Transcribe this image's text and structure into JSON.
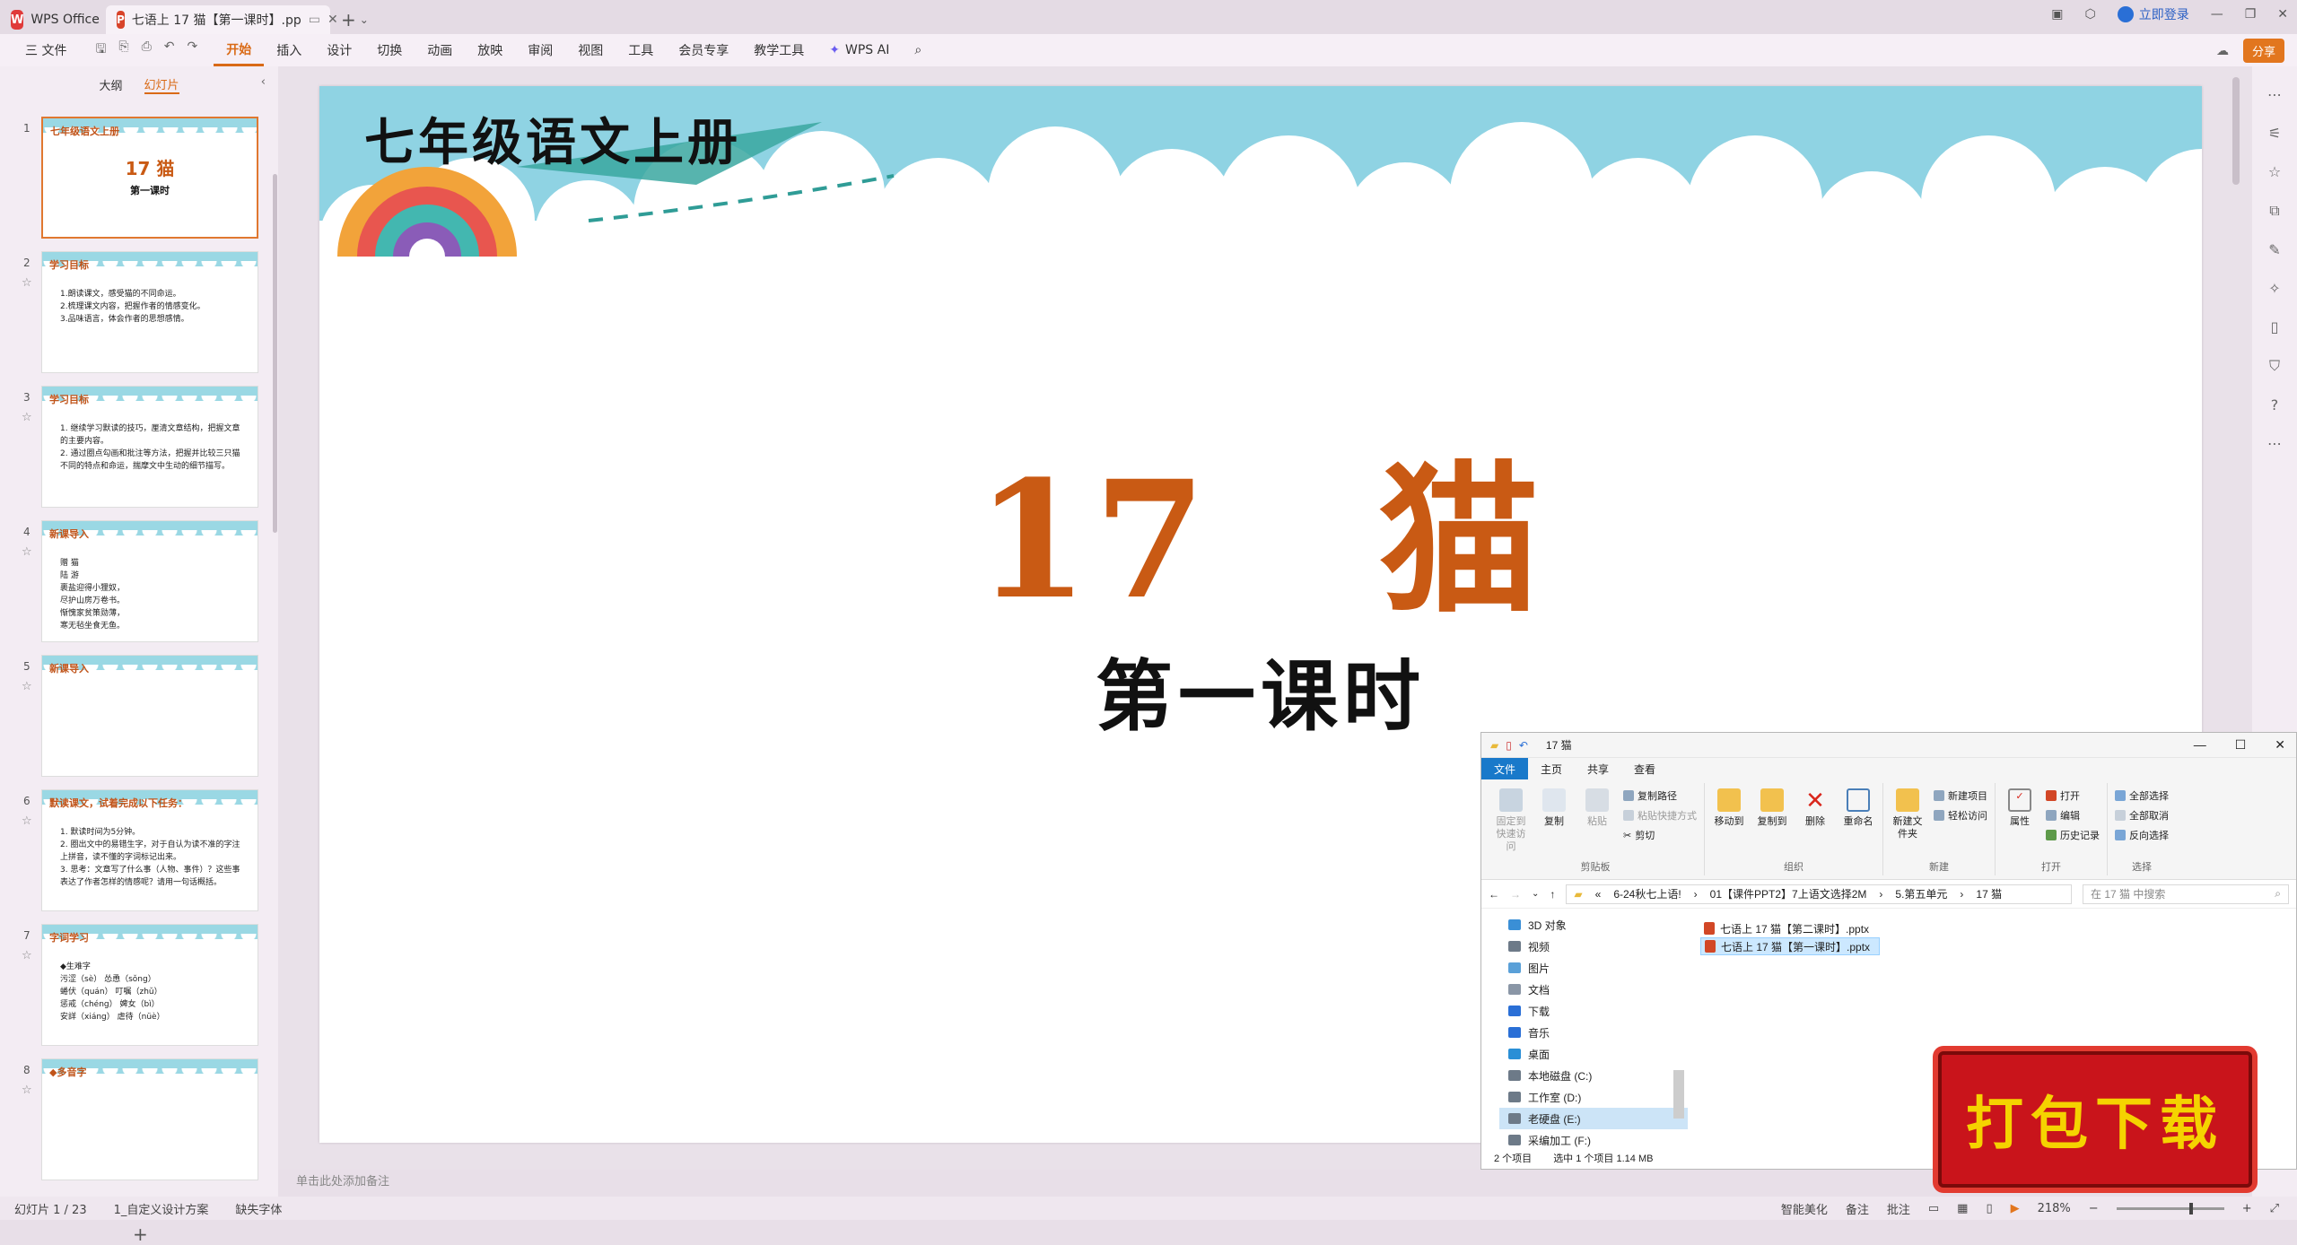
{
  "app": {
    "home_tab": "WPS Office",
    "doc_tab": "七语上 17 猫【第一课时】.pp",
    "login": "立即登录",
    "share": "分享"
  },
  "ribbon": {
    "file_menu": "三 文件",
    "tabs": [
      "开始",
      "插入",
      "设计",
      "切换",
      "动画",
      "放映",
      "审阅",
      "视图",
      "工具",
      "会员专享",
      "教学工具"
    ],
    "wps_ai": "WPS AI"
  },
  "left_panel": {
    "tab_outline": "大纲",
    "tab_slides": "幻灯片",
    "slides": [
      {
        "num": "1",
        "title": "七年级语文上册",
        "big": "17  猫",
        "sub": "第一课时"
      },
      {
        "num": "2",
        "title": "学习目标",
        "lines": [
          "1.朗读课文，感受猫的不同命运。",
          "2.梳理课文内容，把握作者的情感变化。",
          "3.品味语言，体会作者的思想感情。"
        ]
      },
      {
        "num": "3",
        "title": "学习目标",
        "lines": [
          "1. 继续学习默读的技巧，厘清文章结构，把握文章的主要内容。",
          "2. 通过圈点勾画和批注等方法，把握并比较三只猫不同的特点和命运，揣摩文中生动的细节描写。"
        ]
      },
      {
        "num": "4",
        "title": "新课导入",
        "lines": [
          "赠 猫",
          "陆 游",
          "裹盐迎得小狸奴，",
          "尽护山房万卷书。",
          "惭愧家贫策勋薄，",
          "寒无毡坐食无鱼。"
        ]
      },
      {
        "num": "5",
        "title": "新课导入",
        "lines": []
      },
      {
        "num": "6",
        "title": "默读课文，试着完成以下任务：",
        "lines": [
          "1. 默读时间为5分钟。",
          "2. 圈出文中的易错生字，对于自认为读不准的字注上拼音，读不懂的字词标记出来。",
          "3. 思考：文章写了什么事（人物、事件）？这些事表达了作者怎样的情感呢？请用一句话概括。"
        ]
      },
      {
        "num": "7",
        "title": "字词学习",
        "lines": [
          "◆生难字",
          "污涩（sè） 怂恿（sǒng）",
          "蜷伏（quán） 叮嘱（zhǔ）",
          "惩戒（chéng） 婢女（bì）",
          "安詳（xiáng） 虐待（nüè）"
        ]
      },
      {
        "num": "8",
        "title": "◆多音字",
        "lines": []
      }
    ]
  },
  "slide": {
    "header": "七年级语文上册",
    "title": "17　猫",
    "subtitle": "第一课时"
  },
  "notes_placeholder": "单击此处添加备注",
  "status": {
    "slide_count": "幻灯片 1 / 23",
    "theme": "1_自定义设计方案",
    "missing_font": "缺失字体",
    "beautify": "智能美化",
    "notes": "备注",
    "comments": "批注",
    "zoom": "218%",
    "zoom_level_fraction": 0.7
  },
  "explorer": {
    "title": "17 猫",
    "tabs": [
      "文件",
      "主页",
      "共享",
      "查看"
    ],
    "groups": {
      "clipboard": {
        "label": "剪贴板",
        "pin": "固定到快速访问",
        "copy": "复制",
        "paste": "粘贴",
        "copy_path": "复制路径",
        "paste_shortcut": "粘贴快捷方式",
        "cut": "剪切"
      },
      "organize": {
        "label": "组织",
        "move_to": "移动到",
        "copy_to": "复制到",
        "delete": "删除",
        "rename": "重命名"
      },
      "new": {
        "label": "新建",
        "new_folder": "新建文件夹",
        "new_item": "新建项目",
        "easy_access": "轻松访问"
      },
      "open": {
        "label": "打开",
        "properties": "属性",
        "open": "打开",
        "edit": "编辑",
        "history": "历史记录"
      },
      "select": {
        "label": "选择",
        "select_all": "全部选择",
        "select_none": "全部取消",
        "invert": "反向选择"
      }
    },
    "address": [
      "«",
      "6-24秋七上语!",
      "›",
      "01【课件PPT2】7上语文选择2M",
      "›",
      "5.第五单元",
      "›",
      "17 猫"
    ],
    "search_placeholder": "在 17 猫 中搜索",
    "nav": [
      "3D 对象",
      "视频",
      "图片",
      "文档",
      "下载",
      "音乐",
      "桌面",
      "本地磁盘 (C:)",
      "工作室 (D:)",
      "老硬盘 (E:)",
      "采编加工 (F:)"
    ],
    "nav_selected": "老硬盘 (E:)",
    "files": [
      "七语上 17 猫【第二课时】.pptx",
      "七语上 17 猫【第一课时】.pptx"
    ],
    "status": [
      "2 个项目",
      "选中 1 个项目  1.14 MB"
    ]
  },
  "promo": "打包下载",
  "colors": {
    "accent": "#d96a16",
    "slide_title": "#c95a14",
    "sky": "#8fd3e3",
    "promo_bg": "#c9141b",
    "promo_text": "#f5d300"
  }
}
